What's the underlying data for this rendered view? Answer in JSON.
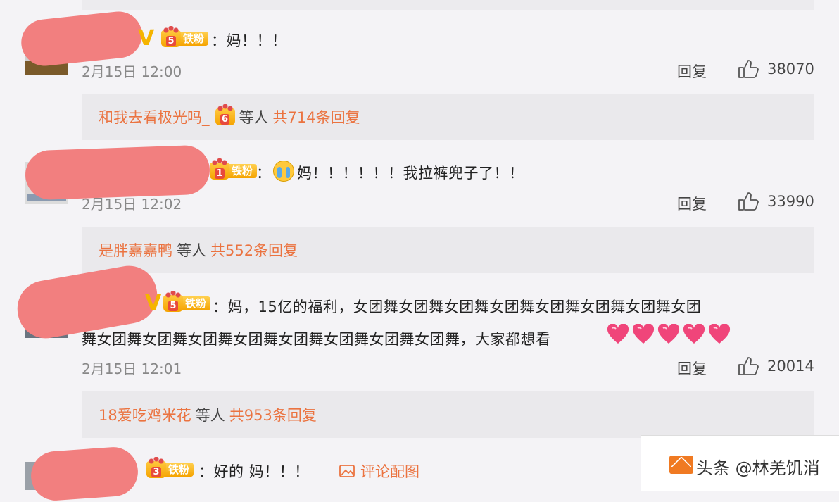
{
  "comments": [
    {
      "badge_level": "5",
      "badge_label": "铁粉",
      "separator": "：",
      "text": "妈！！！",
      "time": "2月15日 12:00",
      "reply_label": "回复",
      "likes": "38070",
      "sub": {
        "name": "和我去看极光吗_",
        "crown_level": "6",
        "mid": "等人",
        "count": "共714条回复"
      }
    },
    {
      "badge_level": "1",
      "badge_label": "铁粉",
      "separator": "：",
      "text": "妈！！！！！！我拉裤兜子了！！",
      "time": "2月15日 12:02",
      "reply_label": "回复",
      "likes": "33990",
      "sub": {
        "name": "是胖嘉嘉鸭",
        "mid": "等人",
        "count": "共552条回复"
      }
    },
    {
      "badge_level": "5",
      "badge_label": "铁粉",
      "separator": "：",
      "text": "妈，15亿的福利，女团舞女团舞女团舞女团舞女团舞女团舞女团舞女团",
      "text_line2": "舞女团舞女团舞女团舞女团舞女团舞女团舞女团舞女团舞，大家都想看",
      "time": "2月15日 12:01",
      "reply_label": "回复",
      "likes": "20014",
      "sub": {
        "name": "18爱吃鸡米花",
        "mid": "等人",
        "count": "共953条回复"
      }
    },
    {
      "badge_level": "3",
      "badge_label": "铁粉",
      "separator": "：",
      "text": "好的 妈！！！",
      "pic_link": "评论配图"
    }
  ],
  "watermark": "头条 @林羌饥消",
  "colors": {
    "accent": "#eb7340",
    "redact": "#f27f7f",
    "badge": "#f5a300"
  }
}
